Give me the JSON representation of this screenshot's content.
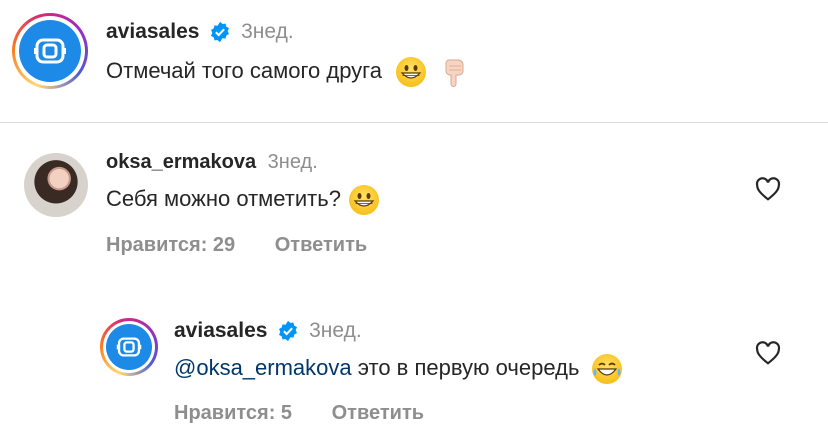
{
  "comments": [
    {
      "username": "aviasales",
      "verified": true,
      "time": "3нед.",
      "text": "Отмечай того самого друга",
      "emoji": [
        "grinning-face",
        "backhand-index-pointing-down"
      ]
    },
    {
      "username": "oksa_ermakova",
      "verified": false,
      "time": "3нед.",
      "text": "Себя можно отметить?",
      "emoji": [
        "grinning-face"
      ],
      "likes": "Нравится: 29",
      "reply": "Ответить"
    },
    {
      "username": "aviasales",
      "verified": true,
      "time": "3нед.",
      "mention": "@oksa_ermakova",
      "text": " это в первую очередь",
      "emoji": [
        "face-with-tears-of-joy"
      ],
      "likes": "Нравится: 5",
      "reply": "Ответить"
    }
  ],
  "colors": {
    "brand": "#1c8ae6",
    "verified": "#0095f6",
    "secondary_text": "#8e8e8e",
    "mention": "#00376b"
  }
}
